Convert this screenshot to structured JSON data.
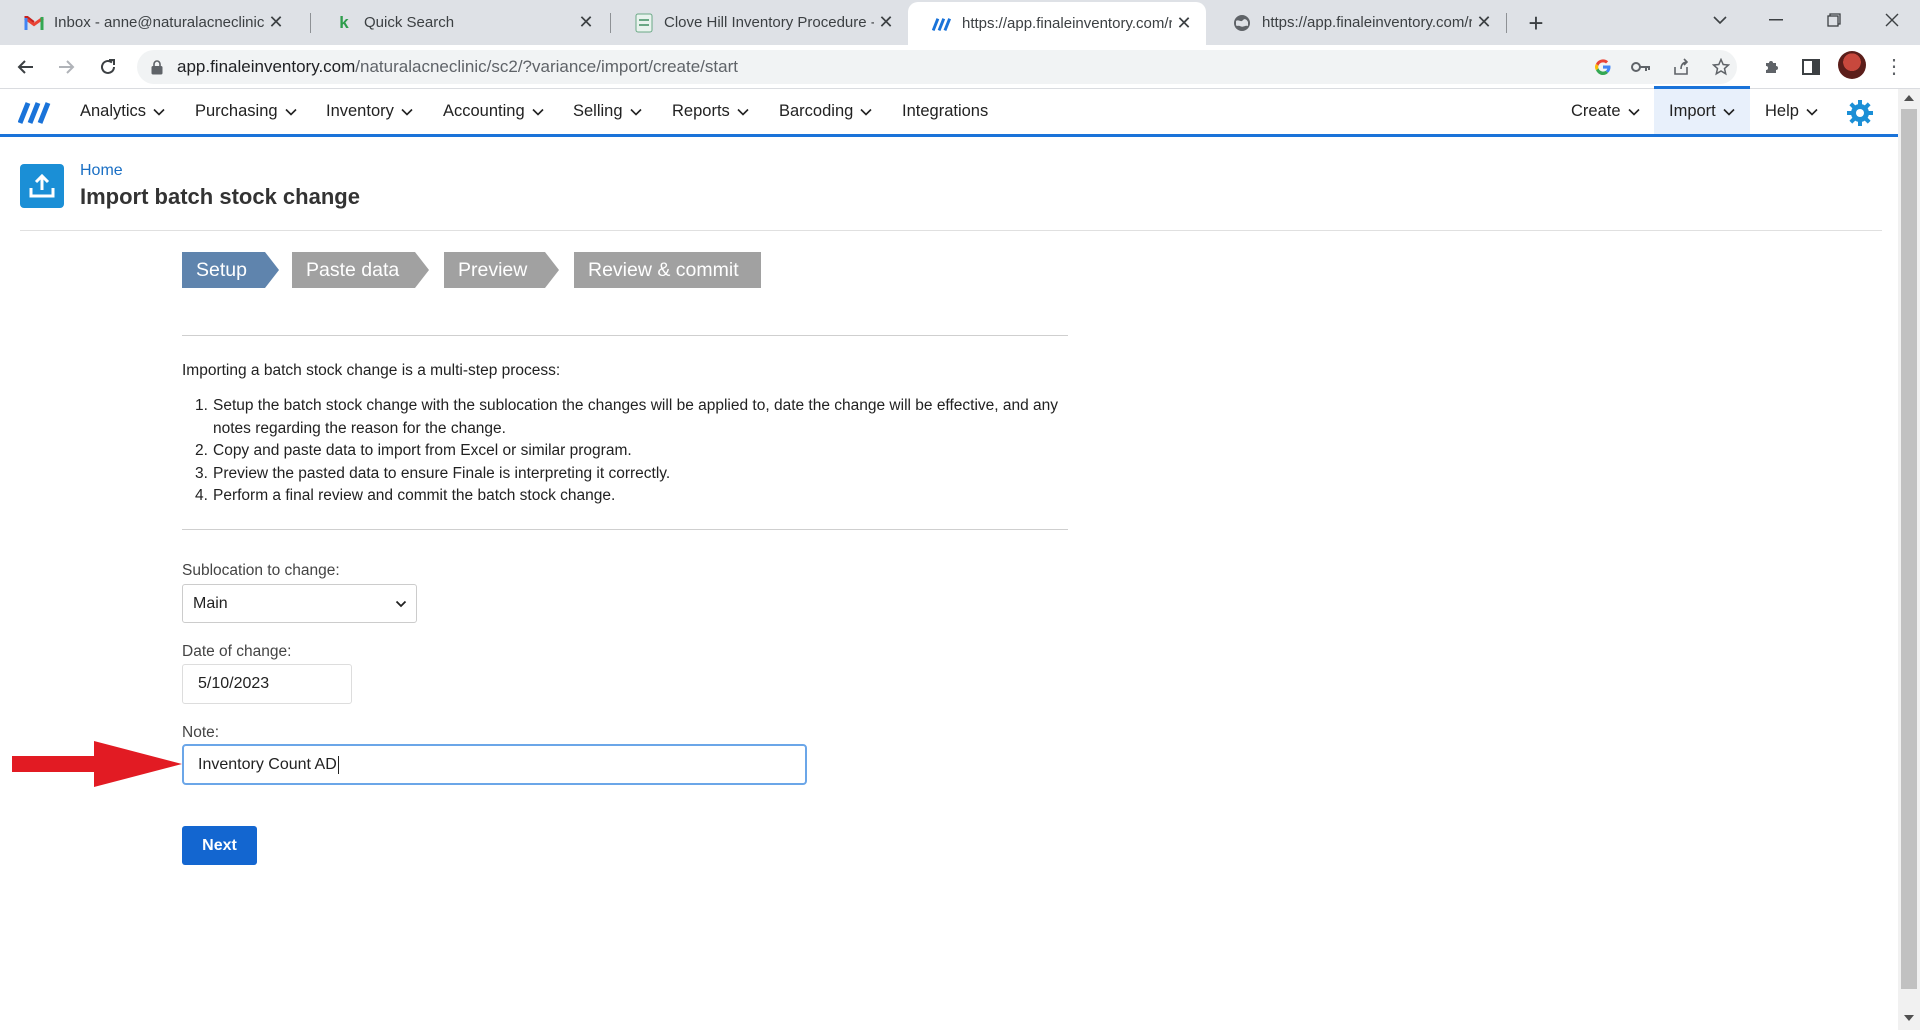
{
  "browser": {
    "tabs": [
      {
        "title": "Inbox - anne@naturalacneclinic.c",
        "icon": "gmail-icon"
      },
      {
        "title": "Quick Search",
        "icon": "k-logo-icon"
      },
      {
        "title": "Clove Hill Inventory Procedure - ",
        "icon": "document-icon"
      },
      {
        "title": "https://app.finaleinventory.com/r",
        "icon": "finale-logo-icon",
        "active": true
      },
      {
        "title": "https://app.finaleinventory.com/r",
        "icon": "globe-icon"
      }
    ],
    "url_host": "app.finaleinventory.com",
    "url_path": "/naturalacneclinic/sc2/?variance/import/create/start"
  },
  "nav": {
    "items": [
      "Analytics",
      "Purchasing",
      "Inventory",
      "Accounting",
      "Selling",
      "Reports",
      "Barcoding",
      "Integrations"
    ],
    "right": [
      "Create",
      "Import",
      "Help"
    ],
    "active": "Import",
    "accent": "#1a73d9"
  },
  "page": {
    "breadcrumb": "Home",
    "title": "Import batch stock change",
    "steps": [
      "Setup",
      "Paste data",
      "Preview",
      "Review & commit"
    ],
    "active_step": "Setup",
    "intro": "Importing a batch stock change is a multi-step process:",
    "list": [
      {
        "num": "1.",
        "text": "Setup the batch stock change with the sublocation the changes will be applied to, date the change will be effective, and any notes regarding the reason for the change."
      },
      {
        "num": "2.",
        "text": "Copy and paste data to import from Excel or similar program."
      },
      {
        "num": "3.",
        "text": "Preview the pasted data to ensure Finale is interpreting it correctly."
      },
      {
        "num": "4.",
        "text": "Perform a final review and commit the batch stock change."
      }
    ],
    "form": {
      "sublocation_label": "Sublocation to change:",
      "sublocation_value": "Main",
      "date_label": "Date of change:",
      "date_value": "5/10/2023",
      "note_label": "Note:",
      "note_value": "Inventory Count AD",
      "next_label": "Next"
    }
  },
  "annotation": {
    "icon": "red-arrow-icon",
    "color": "#e21b23"
  }
}
